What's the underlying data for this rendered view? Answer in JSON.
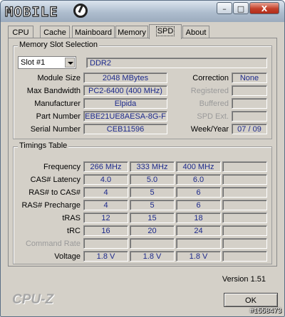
{
  "window": {
    "logo": "MOBILE",
    "buttons": {
      "minimize": "–",
      "maximize": "□",
      "close": "X"
    }
  },
  "tabs": [
    {
      "label": "CPU"
    },
    {
      "label": "Cache"
    },
    {
      "label": "Mainboard"
    },
    {
      "label": "Memory"
    },
    {
      "label": "SPD",
      "active": true
    },
    {
      "label": "About"
    }
  ],
  "slot": {
    "title": "Memory Slot Selection",
    "selected": "Slot #1",
    "type": "DDR2",
    "module_size_label": "Module Size",
    "module_size": "2048 MBytes",
    "bandwidth_label": "Max Bandwidth",
    "bandwidth": "PC2-6400 (400 MHz)",
    "manufacturer_label": "Manufacturer",
    "manufacturer": "Elpida",
    "part_label": "Part Number",
    "part": "EBE21UE8AESA-8G-F",
    "serial_label": "Serial Number",
    "serial": "CEB11596",
    "correction_label": "Correction",
    "correction": "None",
    "registered_label": "Registered",
    "registered": "",
    "buffered_label": "Buffered",
    "buffered": "",
    "spdext_label": "SPD Ext.",
    "spdext": "",
    "weekyear_label": "Week/Year",
    "weekyear": "07 / 09"
  },
  "timings": {
    "title": "Timings Table",
    "rows": [
      {
        "label": "Frequency",
        "values": [
          "266 MHz",
          "333 MHz",
          "400 MHz",
          ""
        ]
      },
      {
        "label": "CAS# Latency",
        "values": [
          "4.0",
          "5.0",
          "6.0",
          ""
        ]
      },
      {
        "label": "RAS# to CAS#",
        "values": [
          "4",
          "5",
          "6",
          ""
        ]
      },
      {
        "label": "RAS# Precharge",
        "values": [
          "4",
          "5",
          "6",
          ""
        ]
      },
      {
        "label": "tRAS",
        "values": [
          "12",
          "15",
          "18",
          ""
        ]
      },
      {
        "label": "tRC",
        "values": [
          "16",
          "20",
          "24",
          ""
        ]
      },
      {
        "label": "Command Rate",
        "dim": true,
        "values": [
          "",
          "",
          "",
          ""
        ]
      },
      {
        "label": "Voltage",
        "values": [
          "1.8 V",
          "1.8 V",
          "1.8 V",
          ""
        ]
      }
    ]
  },
  "footer": {
    "version": "Version 1.51",
    "brand": "CPU-Z",
    "ok": "OK",
    "watermark": "#1558473"
  }
}
